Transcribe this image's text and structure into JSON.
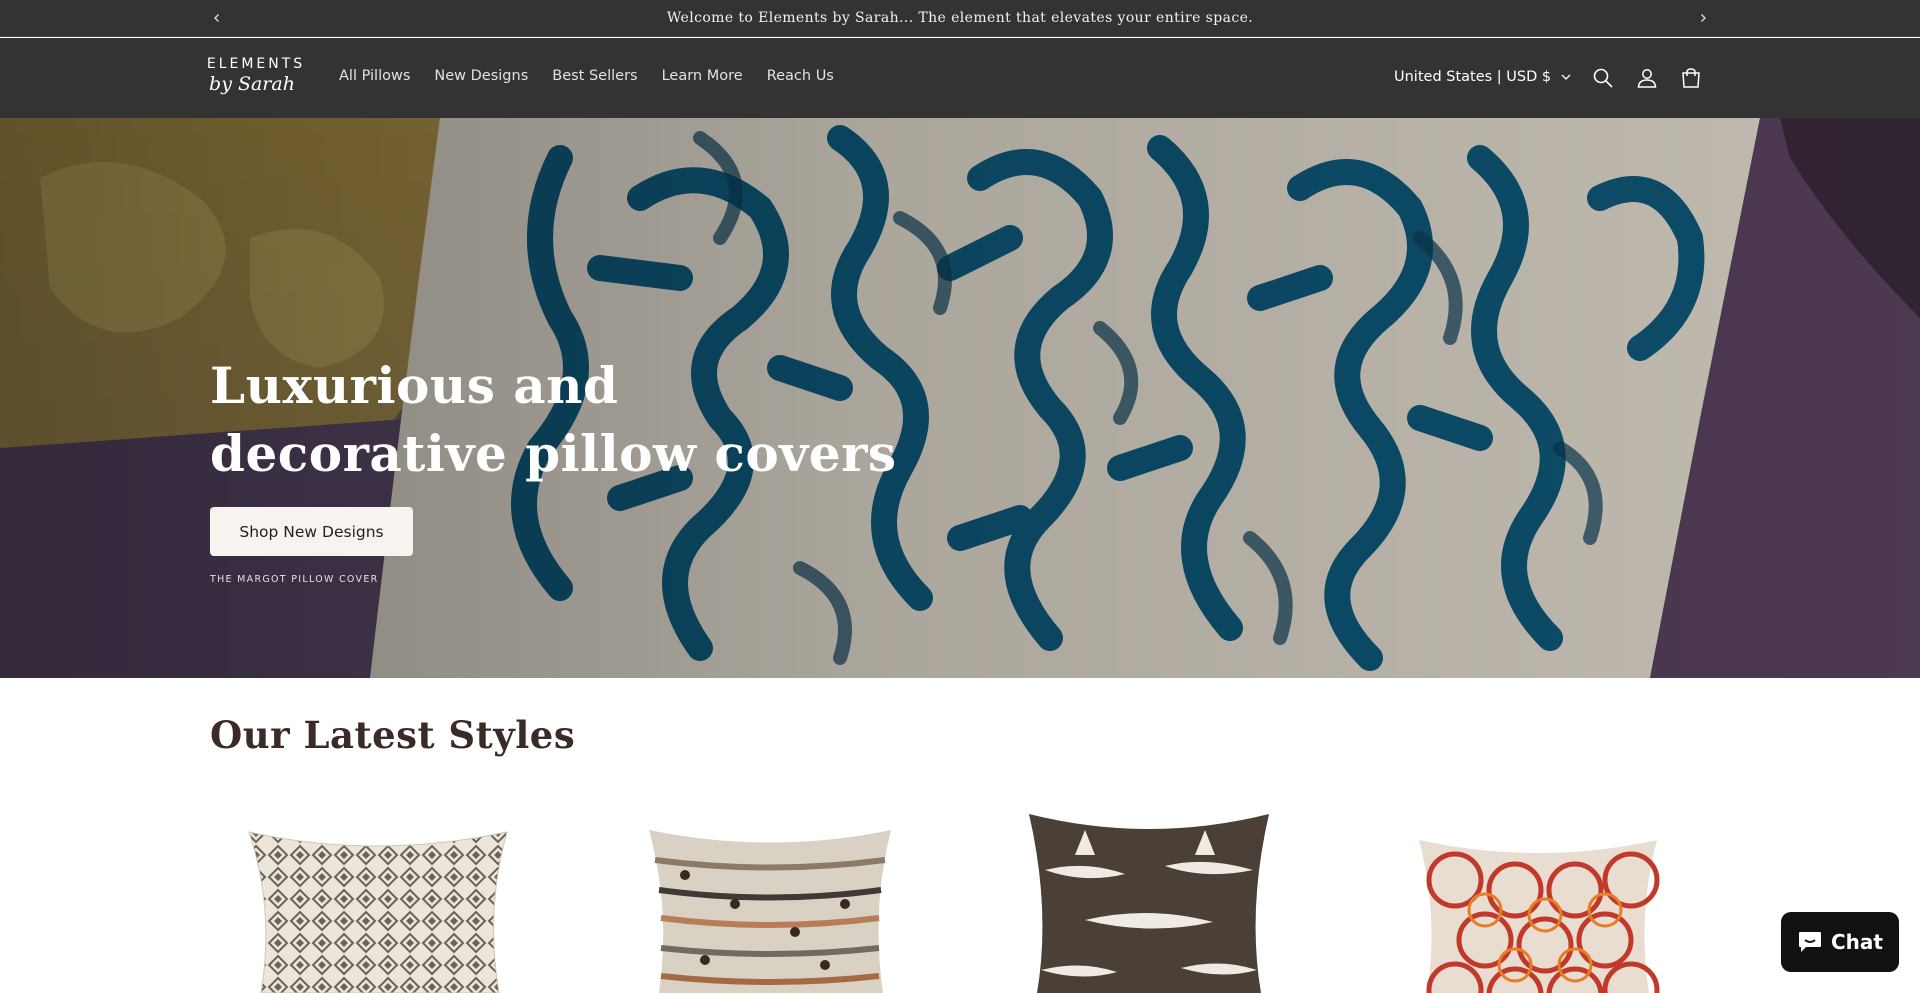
{
  "announcement": {
    "text": "Welcome to Elements by Sarah... The element that elevates your entire space.",
    "prev_icon": "chevron-left-icon",
    "next_icon": "chevron-right-icon"
  },
  "header": {
    "logo_top": "ELEMENTS",
    "logo_bottom": "by Sarah",
    "nav": [
      "All Pillows",
      "New Designs",
      "Best Sellers",
      "Learn More",
      "Reach Us"
    ],
    "country_selector": "United States | USD $",
    "icons": [
      "search-icon",
      "account-icon",
      "cart-icon"
    ]
  },
  "hero": {
    "title": "Luxurious and decorative pillow covers",
    "button": "Shop New Designs",
    "caption": "THE MARGOT PILLOW COVER"
  },
  "latest": {
    "title": "Our Latest Styles",
    "products": [
      "pillow-cream-geometric",
      "pillow-striped-woven",
      "pillow-brown-ikat",
      "pillow-red-trellis"
    ]
  },
  "chat": {
    "label": "Chat",
    "icon": "chat-bubble-icon"
  },
  "colors": {
    "header_bg": "#333333",
    "button_bg": "#f8f3ee",
    "section_title": "#3b2b26",
    "chat_bg": "#111111"
  }
}
